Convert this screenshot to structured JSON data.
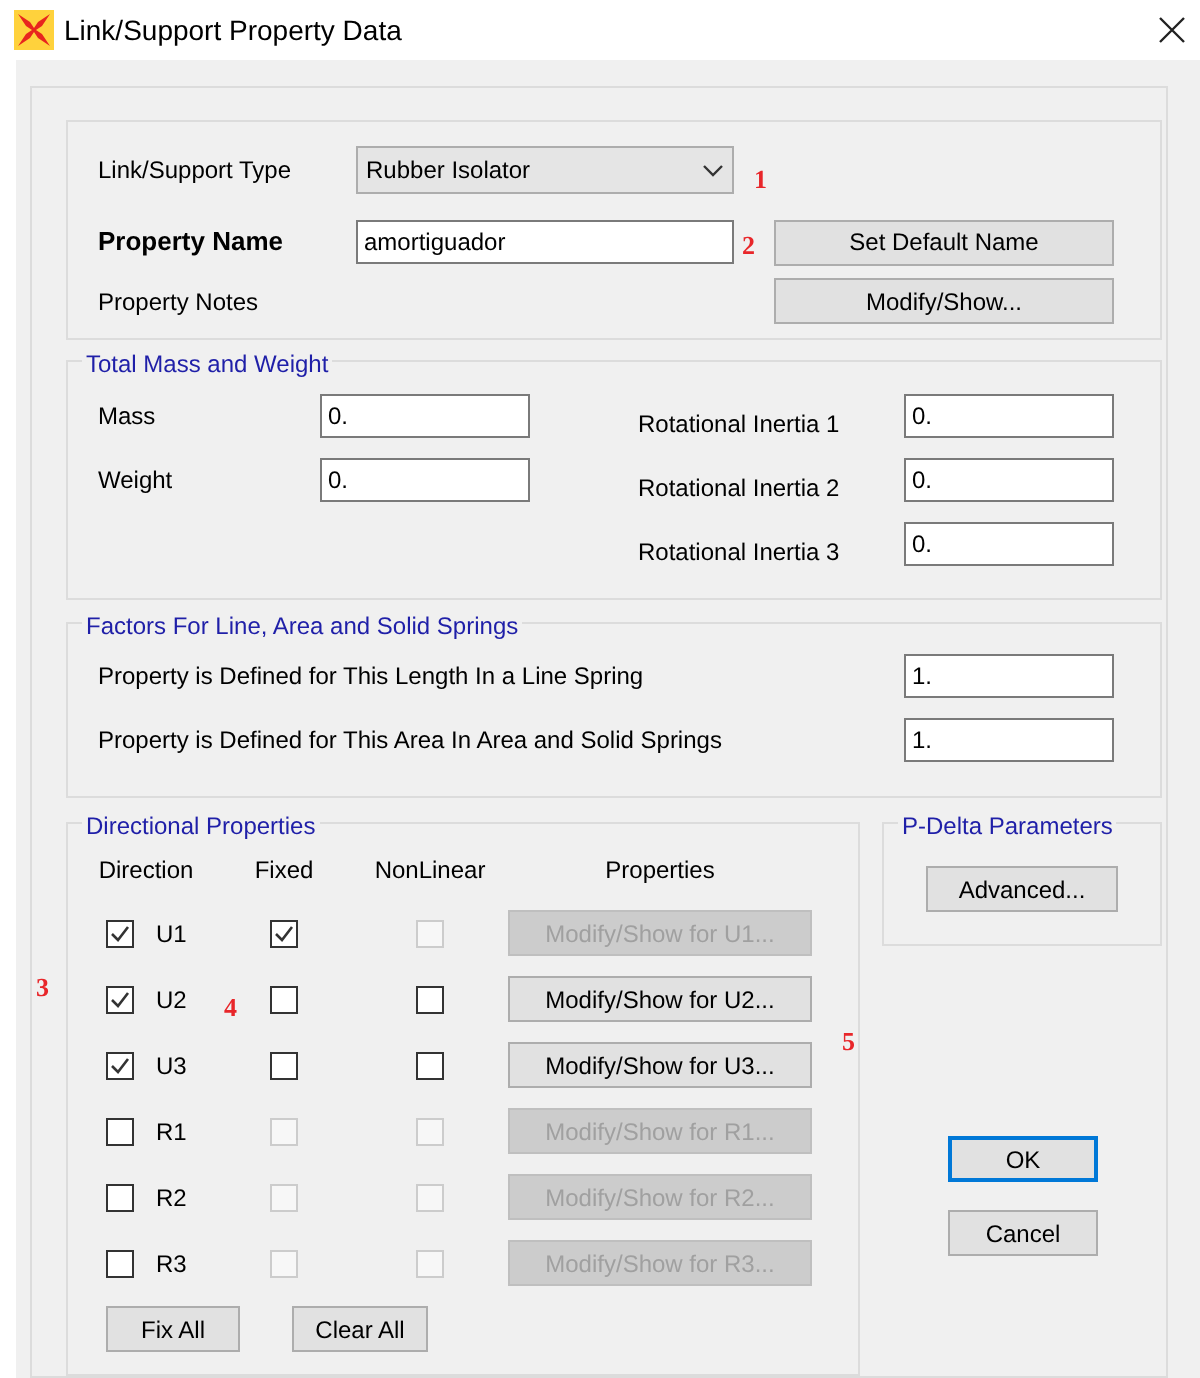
{
  "window": {
    "title": "Link/Support Property Data"
  },
  "link_type": {
    "label": "Link/Support Type",
    "value": "Rubber Isolator"
  },
  "property_name": {
    "label": "Property Name",
    "value": "amortiguador"
  },
  "property_notes": {
    "label": "Property Notes"
  },
  "set_default_button": "Set Default Name",
  "notes_button": "Modify/Show...",
  "mass_group": {
    "title": "Total Mass and Weight",
    "left_fields": [
      {
        "label": "Mass",
        "value": "0."
      },
      {
        "label": "Weight",
        "value": "0."
      }
    ],
    "right_fields": [
      {
        "label": "Rotational Inertia 1",
        "value": "0."
      },
      {
        "label": "Rotational Inertia 2",
        "value": "0."
      },
      {
        "label": "Rotational Inertia 3",
        "value": "0."
      }
    ]
  },
  "factors_group": {
    "title": "Factors For Line, Area and Solid Springs",
    "fields": [
      {
        "label": "Property is Defined for This Length In a Line Spring",
        "value": "1."
      },
      {
        "label": "Property is Defined for This Area In Area and Solid Springs",
        "value": "1."
      }
    ]
  },
  "directional": {
    "title": "Directional Properties",
    "columns": [
      "Direction",
      "Fixed",
      "NonLinear",
      "Properties"
    ],
    "rows": [
      {
        "direction": "U1",
        "checked": true,
        "fixed": {
          "checked": true,
          "disabled": false
        },
        "nonlinear": {
          "checked": false,
          "disabled": true
        },
        "button": {
          "label": "Modify/Show for U1...",
          "disabled": true
        }
      },
      {
        "direction": "U2",
        "checked": true,
        "fixed": {
          "checked": false,
          "disabled": false
        },
        "nonlinear": {
          "checked": false,
          "disabled": false
        },
        "button": {
          "label": "Modify/Show for U2...",
          "disabled": false
        }
      },
      {
        "direction": "U3",
        "checked": true,
        "fixed": {
          "checked": false,
          "disabled": false
        },
        "nonlinear": {
          "checked": false,
          "disabled": false
        },
        "button": {
          "label": "Modify/Show for U3...",
          "disabled": false
        }
      },
      {
        "direction": "R1",
        "checked": false,
        "fixed": {
          "checked": false,
          "disabled": true
        },
        "nonlinear": {
          "checked": false,
          "disabled": true
        },
        "button": {
          "label": "Modify/Show for R1...",
          "disabled": true
        }
      },
      {
        "direction": "R2",
        "checked": false,
        "fixed": {
          "checked": false,
          "disabled": true
        },
        "nonlinear": {
          "checked": false,
          "disabled": true
        },
        "button": {
          "label": "Modify/Show for R2...",
          "disabled": true
        }
      },
      {
        "direction": "R3",
        "checked": false,
        "fixed": {
          "checked": false,
          "disabled": true
        },
        "nonlinear": {
          "checked": false,
          "disabled": true
        },
        "button": {
          "label": "Modify/Show for R3...",
          "disabled": true
        }
      }
    ],
    "fix_all_button": "Fix All",
    "clear_all_button": "Clear All"
  },
  "pdelta": {
    "title": "P-Delta Parameters",
    "button": "Advanced..."
  },
  "ok_button": "OK",
  "cancel_button": "Cancel",
  "annotations": [
    "1",
    "2",
    "3",
    "4",
    "5"
  ]
}
